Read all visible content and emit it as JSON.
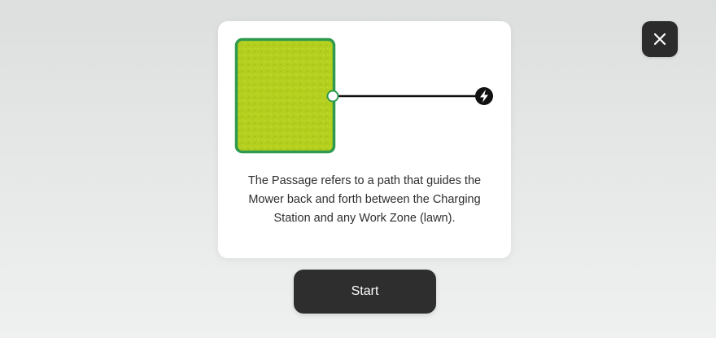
{
  "close_button": {
    "icon": "close-icon"
  },
  "illustration": {
    "zone": "work-zone-lawn",
    "passage": "passage-line",
    "station_icon": "lightning-bolt-icon",
    "colors": {
      "lawn_fill": "#b4cf1e",
      "lawn_border": "#2e9a4e",
      "line": "#111111",
      "node_stroke": "#2e9a4e"
    }
  },
  "description": {
    "line_1": "The Passage refers to a path that guides the",
    "line_2": "Mower back and forth between the Charging",
    "line_3": "Station and any Work Zone (lawn)."
  },
  "start_button": {
    "label": "Start"
  }
}
